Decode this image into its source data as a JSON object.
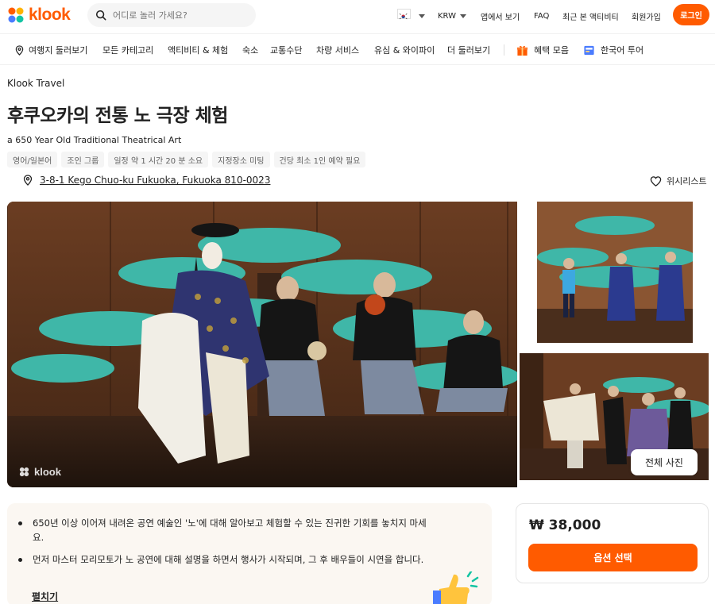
{
  "header": {
    "logo_text": "klook",
    "search_placeholder": "어디로 놀러 가세요?",
    "currency": "KRW",
    "app_link": "앱에서 보기",
    "faq": "FAQ",
    "recent": "최근 본 액티비티",
    "signup": "회원가입",
    "login": "로그인"
  },
  "subnav": {
    "items": [
      "여행지 둘러보기",
      "모든 카테고리",
      "액티비티 & 체험",
      "숙소",
      "교통수단",
      "차량 서비스",
      "유심 & 와이파이",
      "더 둘러보기",
      "혜택 모음",
      "한국어 투어"
    ]
  },
  "activity": {
    "brand": "Klook Travel",
    "title": "후쿠오카의 전통 노 극장 체험",
    "subtitle": "a 650 Year Old Traditional Theatrical Art",
    "chips": [
      "영어/일본어",
      "조인 그룹",
      "일정 약 1 시간 20 분 소요",
      "지정장소 미팅",
      "건당 최소 1인 예약 필요"
    ],
    "address": "3-8-1 Kego Chuo-ku Fukuoka, Fukuoka 810-0023",
    "wishlist": "위시리스트"
  },
  "gallery": {
    "watermark": "klook",
    "all_photos": "전체 사진"
  },
  "highlights": {
    "items": [
      "650년 이상 이어져 내려온 공연 예술인 '노'에 대해 알아보고 체험할 수 있는 진귀한 기회를 놓치지 마세요.",
      "먼저 마스터 모리모토가 노 공연에 대해 설명을 하면서 행사가 시작되며, 그 후 배우들이 시연을 합니다."
    ],
    "expand": "펼치기"
  },
  "booking": {
    "price": "₩ 38,000",
    "select_button": "옵션 선택"
  },
  "colors": {
    "brand": "#ff5b00",
    "highlight_bg": "#fbf7f2"
  }
}
